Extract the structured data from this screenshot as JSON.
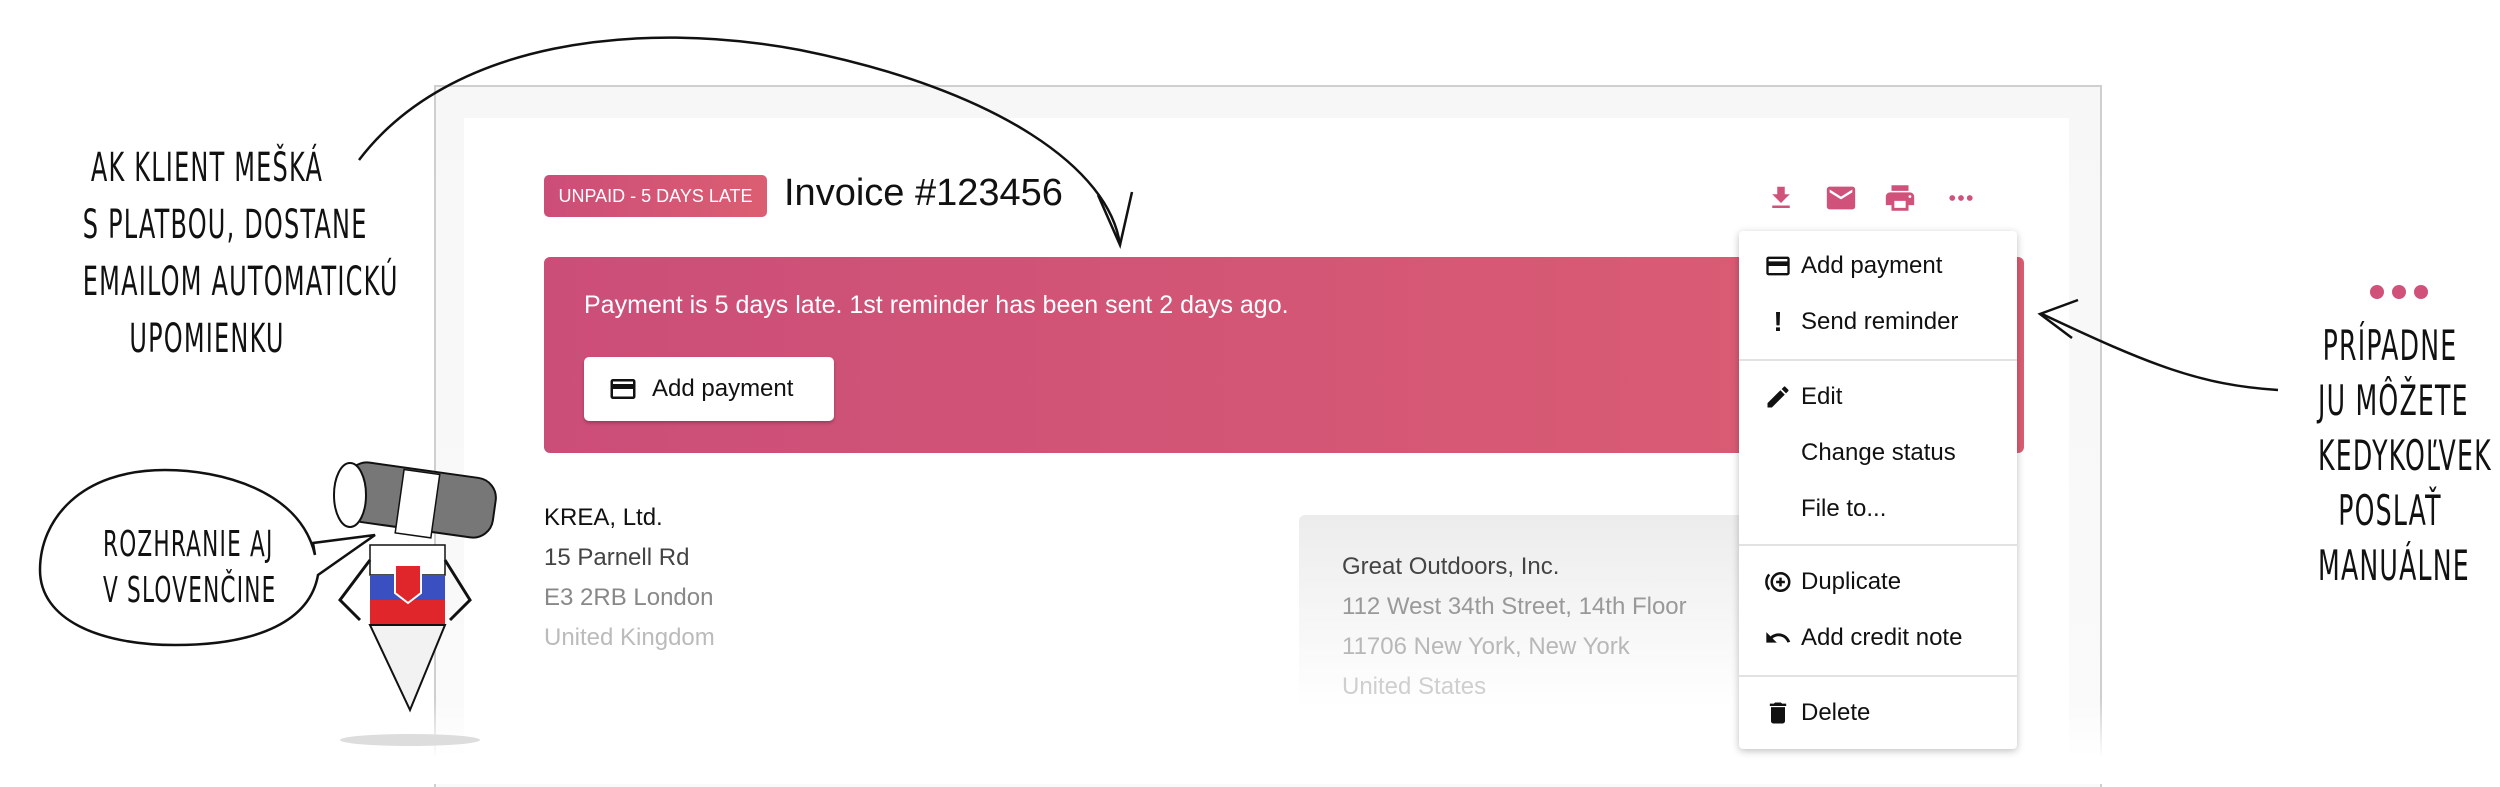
{
  "invoice": {
    "status_badge": "UNPAID - 5 DAYS LATE",
    "title": "Invoice #123456",
    "toolbar": {
      "icons": [
        "download-icon",
        "email-icon",
        "print-icon",
        "more-icon"
      ]
    },
    "banner": {
      "message": "Payment is 5 days late. 1st reminder has been sent 2 days ago.",
      "button_label": "Add payment"
    },
    "sender": {
      "lines": [
        "KREA, Ltd.",
        "15 Parnell Rd",
        "E3 2RB London",
        "United Kingdom"
      ]
    },
    "recipient": {
      "lines": [
        "Great Outdoors, Inc.",
        "112 West 34th Street, 14th Floor",
        "11706 New York, New York",
        "United States"
      ]
    },
    "menu": {
      "items": [
        {
          "label": "Add payment",
          "icon": "credit-card-icon"
        },
        {
          "label": "Send reminder",
          "icon": "exclamation-icon"
        },
        {
          "label": "Edit",
          "icon": "pencil-icon"
        },
        {
          "label": "Change status",
          "icon": ""
        },
        {
          "label": "File to...",
          "icon": ""
        },
        {
          "label": "Duplicate",
          "icon": "duplicate-icon"
        },
        {
          "label": "Add credit note",
          "icon": "undo-icon"
        },
        {
          "label": "Delete",
          "icon": "trash-icon"
        }
      ]
    }
  },
  "annotations": {
    "left": [
      "AK KLIENT MEŠKÁ",
      "S PLATBOU, DOSTANE",
      "EMAILOM AUTOMATICKÚ",
      "UPOMIENKU"
    ],
    "bubble": [
      "ROZHRANIE AJ",
      "V SLOVENČINE"
    ],
    "right": [
      "PRÍPADNE",
      "JU MÔŽETE",
      "KEDYKOĽVEK",
      "POSLAŤ",
      "MANUÁLNE"
    ]
  },
  "colors": {
    "accent": "#d0527a",
    "banner_start": "#cb4e79",
    "banner_end": "#dc5e72"
  }
}
